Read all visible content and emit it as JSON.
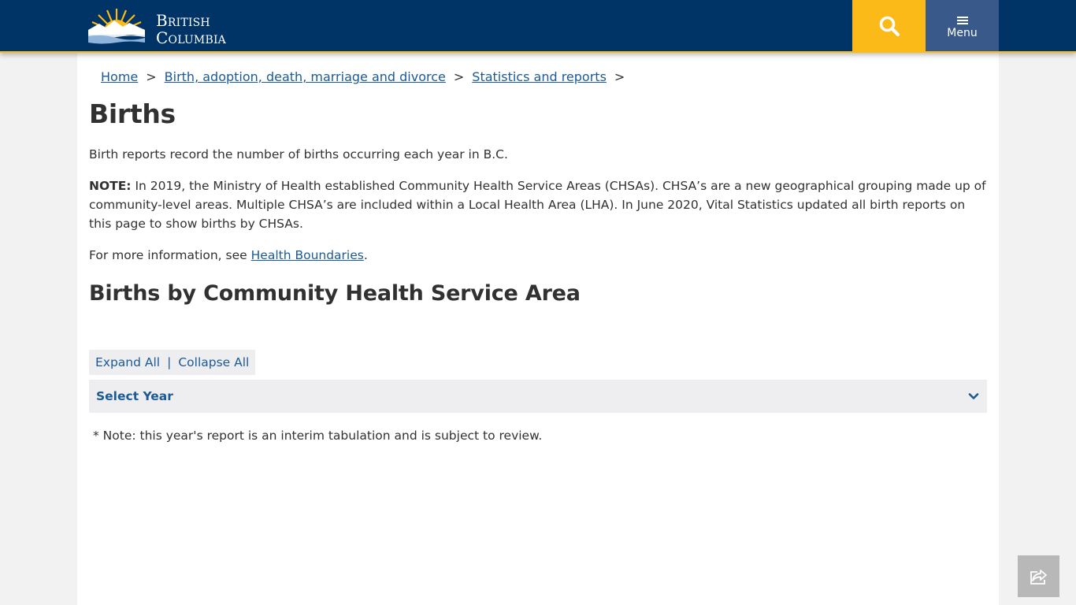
{
  "header": {
    "logo_line1": "British",
    "logo_line2": "Columbia",
    "search_icon": "search-icon",
    "menu_label": "Menu",
    "colors": {
      "navy": "#003366",
      "gold": "#fcba19",
      "menu_bg": "#38598a"
    }
  },
  "breadcrumb": [
    {
      "label": "Home"
    },
    {
      "label": "Birth, adoption, death, marriage and divorce"
    },
    {
      "label": "Statistics and reports"
    }
  ],
  "breadcrumb_separator": ">",
  "page": {
    "title": "Births",
    "intro": "Birth reports record the number of births occurring each year in B.C.",
    "note_label": "NOTE:",
    "note_text": " In 2019, the Ministry of Health established Community Health Service Areas (CHSAs). CHSA’s are a new geographical grouping made up of community-level areas.  Multiple CHSA’s are included within a Local Health Area (LHA). In June 2020, Vital Statistics updated all birth reports on this page to show births by CHSAs.",
    "more_info_prefix": "For more information, see ",
    "more_info_link": "Health Boundaries",
    "more_info_suffix": ".",
    "section_heading": "Births by Community Health Service Area",
    "expand_all": "Expand All",
    "collapse_all": "Collapse All",
    "pipe": "|",
    "accordion_label": "Select Year",
    "footnote": "* Note: this year's report is an interim tabulation and is subject to review."
  },
  "share_button_icon": "share-icon"
}
